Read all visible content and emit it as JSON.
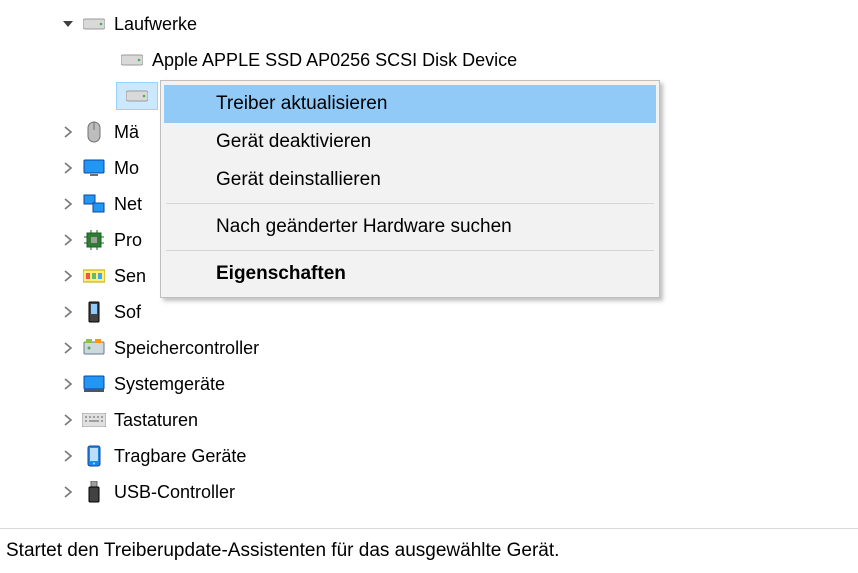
{
  "tree": {
    "drives": {
      "label": "Laufwerke",
      "child1": "Apple APPLE SSD AP0256 SCSI Disk Device"
    },
    "rest": [
      {
        "label": "Mä",
        "icon": "mouse"
      },
      {
        "label": "Mo",
        "icon": "monitor"
      },
      {
        "label": "Net",
        "icon": "network"
      },
      {
        "label": "Pro",
        "icon": "cpu"
      },
      {
        "label": "Sen",
        "icon": "sensor"
      },
      {
        "label": "Sof",
        "icon": "software"
      },
      {
        "label": "Speichercontroller",
        "icon": "storage"
      },
      {
        "label": "Systemgeräte",
        "icon": "system"
      },
      {
        "label": "Tastaturen",
        "icon": "keyboard"
      },
      {
        "label": "Tragbare Geräte",
        "icon": "portable"
      },
      {
        "label": "USB-Controller",
        "icon": "usb"
      }
    ]
  },
  "context_menu": {
    "items": [
      "Treiber aktualisieren",
      "Gerät deaktivieren",
      "Gerät deinstallieren",
      "Nach geänderter Hardware suchen",
      "Eigenschaften"
    ]
  },
  "statusbar": "Startet den Treiberupdate-Assistenten für das ausgewählte Gerät."
}
